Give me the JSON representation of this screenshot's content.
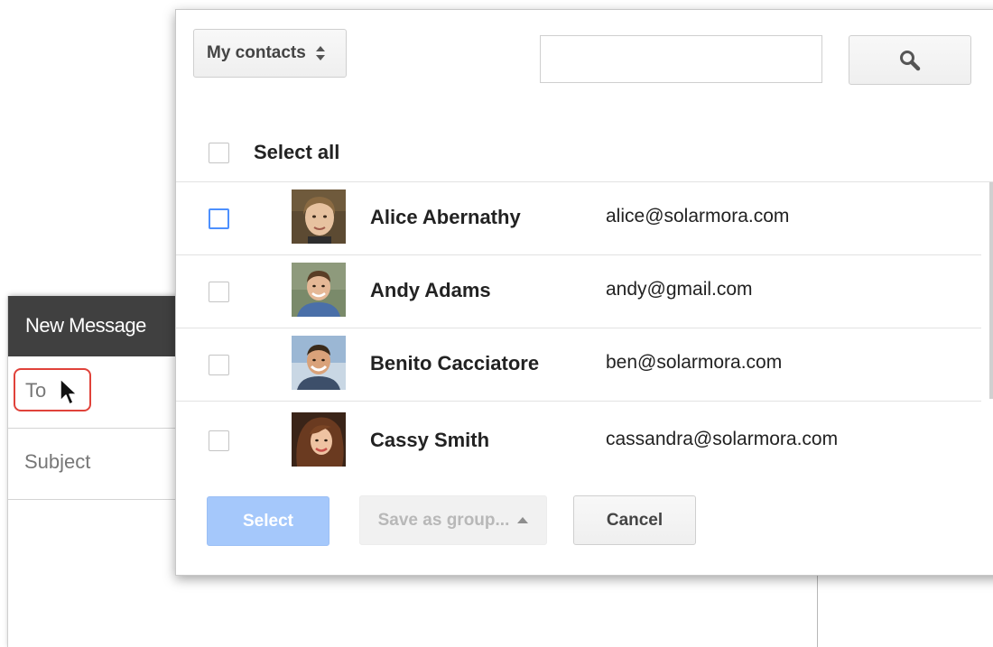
{
  "compose": {
    "title": "New Message",
    "to_label": "To",
    "subject_placeholder": "Subject"
  },
  "dialog": {
    "contacts_dropdown": "My contacts",
    "search_placeholder": "",
    "search_icon": "magnifier-icon",
    "select_all_label": "Select all",
    "contacts": [
      {
        "name": "Alice Abernathy",
        "email": "alice@solarmora.com",
        "checked": false,
        "focused": true
      },
      {
        "name": "Andy Adams",
        "email": "andy@gmail.com",
        "checked": false,
        "focused": false
      },
      {
        "name": "Benito Cacciatore",
        "email": "ben@solarmora.com",
        "checked": false,
        "focused": false
      },
      {
        "name": "Cassy Smith",
        "email": "cassandra@solarmora.com",
        "checked": false,
        "focused": false
      }
    ],
    "footer": {
      "select_label": "Select",
      "save_group_label": "Save as group...",
      "cancel_label": "Cancel"
    }
  },
  "colors": {
    "compose_header": "#404040",
    "to_highlight": "#e0423a",
    "primary_disabled": "#a5c8fb",
    "checkbox_focus": "#4d90fe"
  }
}
